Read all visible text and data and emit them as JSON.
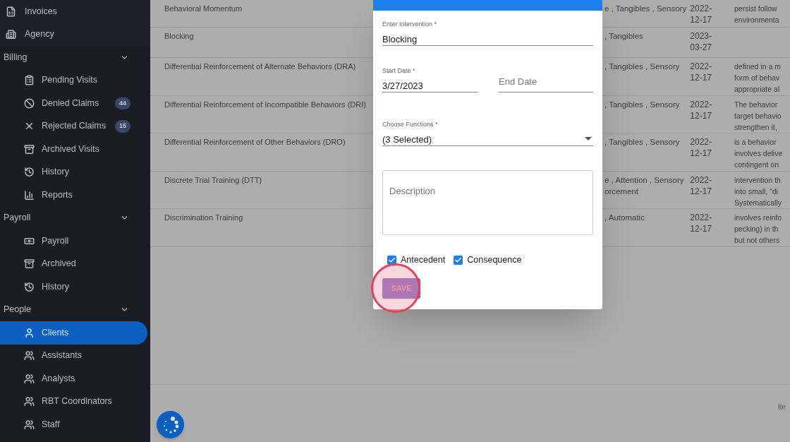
{
  "sidebar": {
    "top_items": [
      {
        "label": "Invoices",
        "selected": false
      },
      {
        "label": "Agency",
        "selected": false
      }
    ],
    "sections": [
      {
        "label": "Billing",
        "expanded": true,
        "children": [
          {
            "label": "Pending Visits",
            "selected": false
          },
          {
            "label": "Denied Claims",
            "badge": "44",
            "selected": false
          },
          {
            "label": "Rejected Claims",
            "badge": "15",
            "selected": false
          },
          {
            "label": "Archived Visits",
            "selected": false
          },
          {
            "label": "History",
            "selected": false
          },
          {
            "label": "Reports",
            "selected": false
          }
        ]
      },
      {
        "label": "Payroll",
        "expanded": true,
        "children": [
          {
            "label": "Payroll",
            "selected": false
          },
          {
            "label": "Archived",
            "selected": false
          },
          {
            "label": "History",
            "selected": false
          }
        ]
      },
      {
        "label": "People",
        "expanded": true,
        "children": [
          {
            "label": "Clients",
            "selected": true
          },
          {
            "label": "Assistants",
            "selected": false
          },
          {
            "label": "Analysts",
            "selected": false
          },
          {
            "label": "RBT Coordinators",
            "selected": false
          },
          {
            "label": "Staff",
            "selected": false
          }
        ]
      }
    ]
  },
  "table": {
    "rows": [
      {
        "name": "Behavioral Momentum",
        "functions": [
          "e , Tangibles , Sensory"
        ],
        "date": [
          "2022-",
          "12-17"
        ],
        "description": [
          "persist follow",
          "environmenta"
        ]
      },
      {
        "name": "Blocking",
        "functions": [
          ", Tangibles"
        ],
        "date": [
          "2023-",
          "03-27"
        ],
        "description": []
      },
      {
        "name": "Differential Reinforcement of Alternate Behaviors (DRA)",
        "functions": [
          ", Tangibles , Sensory"
        ],
        "date": [
          "2022-",
          "12-17"
        ],
        "description": [
          "defined in a m",
          "form of behav",
          "appropriate al"
        ]
      },
      {
        "name": "Differential Reinforcement of Incompatible Behaviors (DRI)",
        "functions": [
          ", Tangibles , Sensory"
        ],
        "date": [
          "2022-",
          "12-17"
        ],
        "description": [
          "The behavior",
          "target behavio",
          "strengthen it,"
        ]
      },
      {
        "name": "Differential Reinforcement of Other Behaviors (DRO)",
        "functions": [
          ", Tangibles , Sensory"
        ],
        "date": [
          "2022-",
          "12-17"
        ],
        "description": [
          "is a behavior",
          "involves delive",
          "contingent on"
        ]
      },
      {
        "name": "Discrete Trial Training (DTT)",
        "functions": [
          "e , Attention , Sensory",
          "orcement"
        ],
        "date": [
          "2022-",
          "12-17"
        ],
        "description": [
          "intervention th",
          "into small, “di",
          "Systematically"
        ]
      },
      {
        "name": "Discrimination Training",
        "functions": [
          ", Automatic"
        ],
        "date": [
          "2022-",
          "12-17"
        ],
        "description": [
          "involves reinfo",
          "pecking) in th",
          "but not others"
        ]
      }
    ],
    "footer": "Ite"
  },
  "dialog": {
    "fields": [
      {
        "kind": "text",
        "label": "Enter Intervention *",
        "value": "Blocking"
      },
      {
        "kind": "dates",
        "start_label": "Start Date *",
        "start_value": "3/27/2023",
        "end_placeholder": "End Date"
      },
      {
        "kind": "select",
        "label": "Choose Functions *",
        "value": "(3 Selected)"
      },
      {
        "kind": "textarea",
        "placeholder": "Description"
      }
    ],
    "checkboxes": [
      {
        "label": "Antecedent",
        "checked": true
      },
      {
        "label": "Consequence",
        "checked": true
      }
    ],
    "save_button": "SAVE",
    "highlighted": true
  }
}
